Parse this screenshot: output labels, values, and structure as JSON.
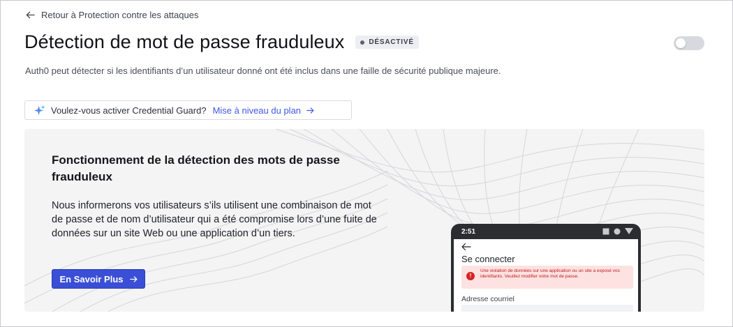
{
  "nav": {
    "back_label": "Retour à Protection contre les attaques"
  },
  "header": {
    "title": "Détection de mot de passe frauduleux",
    "status_badge": "DÉSACTIVÉ",
    "toggle_state": "off"
  },
  "description": "Auth0 peut détecter si les identifiants d’un utilisateur donné ont été inclus dans une faille de sécurité publique majeure.",
  "upgrade_banner": {
    "question": "Voulez-vous activer Credential Guard?",
    "link_label": "Mise à niveau du plan"
  },
  "info_panel": {
    "heading": "Fonctionnement de la détection des mots de passe frauduleux",
    "body": "Nous informerons vos utilisateurs s’ils utilisent une combinaison de mot de passe et de nom d’utilisateur qui a été compromise lors d’une fuite de données sur un site Web ou une application d’un tiers.",
    "button_label": "En Savoir Plus"
  },
  "phone_mockup": {
    "time": "2:51",
    "signin_title": "Se connecter",
    "alert_icon": "!",
    "alert_text": "Une violation de données sur une application ou un site a exposé vos identifiants. Veuillez modifier votre mot de passe.",
    "email_label": "Adresse courriel"
  },
  "colors": {
    "accent": "#3a4fd6",
    "link": "#3f59e4",
    "alert_bg": "#fde2e2",
    "alert_text": "#c41818",
    "panel_bg": "#f4f4f5"
  },
  "icons": [
    "arrow-left-icon",
    "sparkle-icon",
    "arrow-right-icon",
    "alert-icon",
    "phone-status-icons"
  ]
}
